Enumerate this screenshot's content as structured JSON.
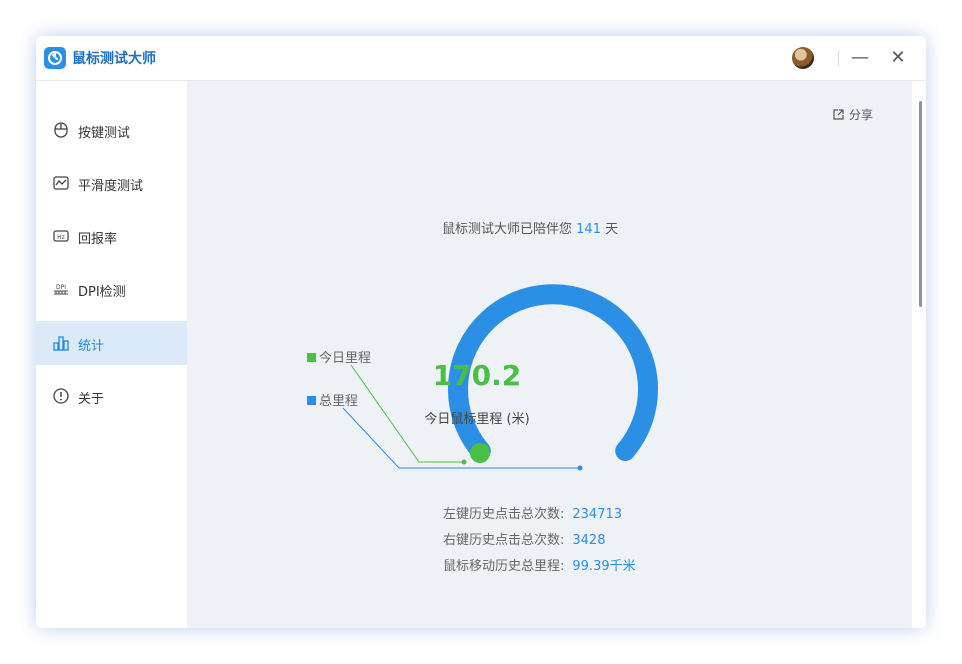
{
  "app": {
    "title": "鼠标测试大师"
  },
  "window_controls": {
    "minimize": "—",
    "close": "✕"
  },
  "sidebar": {
    "items": [
      {
        "label": "按键测试",
        "icon": "mouse-icon",
        "active": false
      },
      {
        "label": "平滑度测试",
        "icon": "wave-chart-icon",
        "active": false
      },
      {
        "label": "回报率",
        "icon": "hz-icon",
        "active": false
      },
      {
        "label": "DPI检测",
        "icon": "dpi-icon",
        "active": false
      },
      {
        "label": "统计",
        "icon": "bar-chart-icon",
        "active": true
      },
      {
        "label": "关于",
        "icon": "info-icon",
        "active": false
      }
    ]
  },
  "main": {
    "share_label": "分享",
    "companion": {
      "prefix": "鼠标测试大师已陪伴您",
      "days": "141",
      "suffix": "天"
    },
    "gauge": {
      "value": "170.2",
      "label": "今日鼠标里程 (米)",
      "legend": [
        {
          "name": "今日里程",
          "color": "#49c043"
        },
        {
          "name": "总里程",
          "color": "#2b8fe6"
        }
      ],
      "accent_blue": "#2b8fe6",
      "accent_green": "#49c043"
    },
    "stats": [
      {
        "label": "左键历史点击总次数:",
        "value": "234713"
      },
      {
        "label": "右键历史点击总次数:",
        "value": "3428"
      },
      {
        "label": "鼠标移动历史总里程:",
        "value": "99.39千米"
      }
    ]
  }
}
